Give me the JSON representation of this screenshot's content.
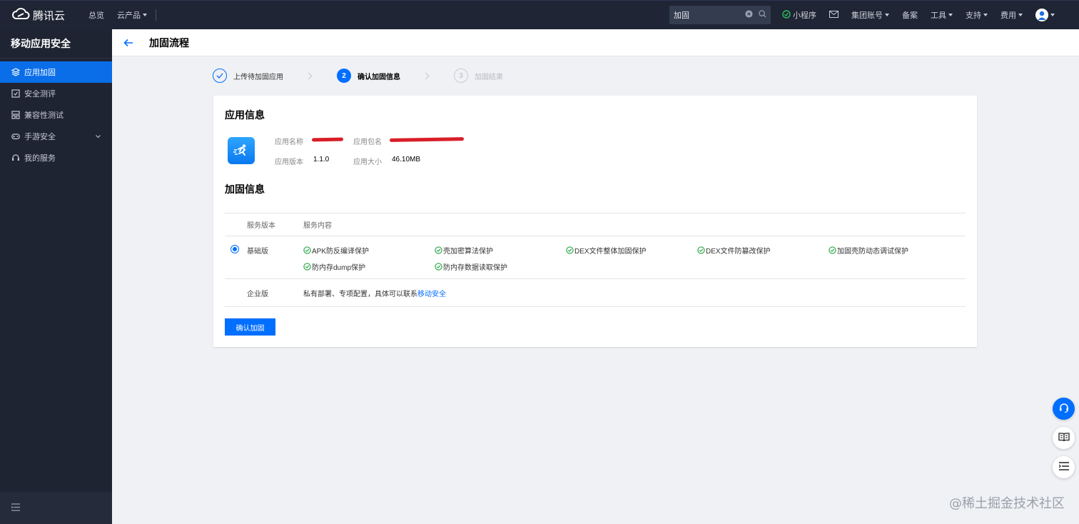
{
  "topbar": {
    "brand": "腾讯云",
    "nav": [
      "总览",
      "云产品"
    ],
    "search_value": "加固",
    "right": {
      "miniprogram": "小程序",
      "group_account": "集团账号",
      "icp": "备案",
      "tools": "工具",
      "support": "支持",
      "billing": "费用"
    }
  },
  "sidebar": {
    "title": "移动应用安全",
    "items": [
      {
        "label": "应用加固",
        "icon": "layers-icon"
      },
      {
        "label": "安全测评",
        "icon": "checkbox-icon"
      },
      {
        "label": "兼容性测试",
        "icon": "grid-icon"
      },
      {
        "label": "手游安全",
        "icon": "gamepad-icon"
      },
      {
        "label": "我的服务",
        "icon": "headset-icon"
      }
    ]
  },
  "header": {
    "title": "加固流程"
  },
  "steps": [
    {
      "num": "1",
      "label": "上传待加固应用",
      "state": "done"
    },
    {
      "num": "2",
      "label": "确认加固信息",
      "state": "active"
    },
    {
      "num": "3",
      "label": "加固结果",
      "state": "todo"
    }
  ],
  "app_info": {
    "title": "应用信息",
    "name_label": "应用名称",
    "package_label": "应用包名",
    "version_label": "应用版本",
    "version": "1.1.0",
    "size_label": "应用大小",
    "size": "46.10MB"
  },
  "hardening": {
    "title": "加固信息",
    "col_version": "服务版本",
    "col_content": "服务内容",
    "basic": {
      "label": "基础版",
      "features": [
        "APK防反编译保护",
        "壳加密算法保护",
        "DEX文件整体加固保护",
        "DEX文件防篡改保护",
        "加固壳防动态调试保护",
        "防内存dump保护",
        "防内存数据读取保护"
      ]
    },
    "enterprise": {
      "label": "企业版",
      "desc": "私有部署、专项配置，具体可以联系",
      "link": "移动安全"
    },
    "confirm_button": "确认加固"
  },
  "colors": {
    "accent": "#006eff",
    "topbar": "#1f2534",
    "sidebar": "#1f2433",
    "check": "#28a745"
  },
  "watermark": "@稀土掘金技术社区"
}
